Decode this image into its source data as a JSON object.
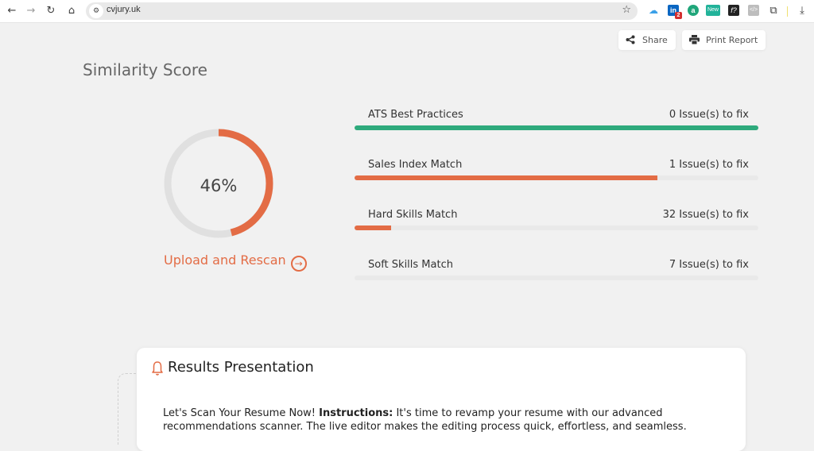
{
  "browser": {
    "url": "cvjury.uk",
    "back_icon": "←",
    "forward_icon": "→",
    "reload_icon": "↻",
    "home_icon": "⌂",
    "bookmark_icon": "☆",
    "extensions": [
      {
        "name": "cloud-extension",
        "glyph": "☁",
        "color": "#3aa0e8"
      },
      {
        "name": "linkedin-extension",
        "glyph": "in",
        "color": "#0a66c2",
        "badge": "2"
      },
      {
        "name": "a-extension",
        "glyph": "a",
        "color": "#20a67a"
      },
      {
        "name": "new-extension",
        "glyph": "New",
        "color": "#22b39a"
      },
      {
        "name": "font-extension",
        "glyph": "f?",
        "color": "#222222"
      },
      {
        "name": "code-extension",
        "glyph": "</>",
        "color": "#bdbdbd"
      }
    ],
    "puzzle_icon": "⧉",
    "download_icon": "⤓"
  },
  "toolbar": {
    "share_label": "Share",
    "print_label": "Print Report"
  },
  "score": {
    "title": "Similarity Score",
    "value": 46,
    "value_label": "46%",
    "rescan_label": "Upload and Rescan",
    "colors": {
      "accent": "#e36c45",
      "track": "#e0e0e0"
    }
  },
  "metrics": [
    {
      "name": "ATS Best Practices",
      "issues": "0 Issue(s) to fix",
      "progress": 1.0,
      "color": "#2eaa7c"
    },
    {
      "name": "Sales Index Match",
      "issues": "1 Issue(s) to fix",
      "progress": 0.75,
      "color": "#e36c45"
    },
    {
      "name": "Hard Skills Match",
      "issues": "32 Issue(s) to fix",
      "progress": 0.09,
      "color": "#e36c45"
    },
    {
      "name": "Soft Skills Match",
      "issues": "7 Issue(s) to fix",
      "progress": 0.0,
      "color": "#e36c45"
    }
  ],
  "results": {
    "title": "Results Presentation",
    "intro": "Let's Scan Your Resume Now! ",
    "instructions_label": "Instructions:",
    "body": " It's time to revamp your resume with our advanced recommendations scanner. The live editor makes the editing process quick, effortless, and seamless."
  }
}
